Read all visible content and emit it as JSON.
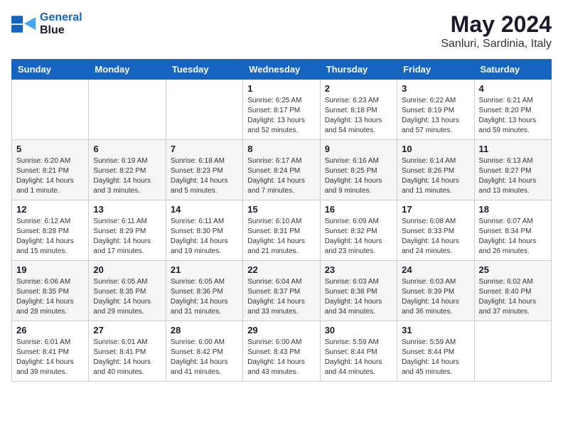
{
  "logo": {
    "line1": "General",
    "line2": "Blue"
  },
  "title": "May 2024",
  "location": "Sanluri, Sardinia, Italy",
  "days_header": [
    "Sunday",
    "Monday",
    "Tuesday",
    "Wednesday",
    "Thursday",
    "Friday",
    "Saturday"
  ],
  "weeks": [
    [
      {
        "day": "",
        "sunrise": "",
        "sunset": "",
        "daylight": ""
      },
      {
        "day": "",
        "sunrise": "",
        "sunset": "",
        "daylight": ""
      },
      {
        "day": "",
        "sunrise": "",
        "sunset": "",
        "daylight": ""
      },
      {
        "day": "1",
        "sunrise": "Sunrise: 6:25 AM",
        "sunset": "Sunset: 8:17 PM",
        "daylight": "Daylight: 13 hours and 52 minutes."
      },
      {
        "day": "2",
        "sunrise": "Sunrise: 6:23 AM",
        "sunset": "Sunset: 8:18 PM",
        "daylight": "Daylight: 13 hours and 54 minutes."
      },
      {
        "day": "3",
        "sunrise": "Sunrise: 6:22 AM",
        "sunset": "Sunset: 8:19 PM",
        "daylight": "Daylight: 13 hours and 57 minutes."
      },
      {
        "day": "4",
        "sunrise": "Sunrise: 6:21 AM",
        "sunset": "Sunset: 8:20 PM",
        "daylight": "Daylight: 13 hours and 59 minutes."
      }
    ],
    [
      {
        "day": "5",
        "sunrise": "Sunrise: 6:20 AM",
        "sunset": "Sunset: 8:21 PM",
        "daylight": "Daylight: 14 hours and 1 minute."
      },
      {
        "day": "6",
        "sunrise": "Sunrise: 6:19 AM",
        "sunset": "Sunset: 8:22 PM",
        "daylight": "Daylight: 14 hours and 3 minutes."
      },
      {
        "day": "7",
        "sunrise": "Sunrise: 6:18 AM",
        "sunset": "Sunset: 8:23 PM",
        "daylight": "Daylight: 14 hours and 5 minutes."
      },
      {
        "day": "8",
        "sunrise": "Sunrise: 6:17 AM",
        "sunset": "Sunset: 8:24 PM",
        "daylight": "Daylight: 14 hours and 7 minutes."
      },
      {
        "day": "9",
        "sunrise": "Sunrise: 6:16 AM",
        "sunset": "Sunset: 8:25 PM",
        "daylight": "Daylight: 14 hours and 9 minutes."
      },
      {
        "day": "10",
        "sunrise": "Sunrise: 6:14 AM",
        "sunset": "Sunset: 8:26 PM",
        "daylight": "Daylight: 14 hours and 11 minutes."
      },
      {
        "day": "11",
        "sunrise": "Sunrise: 6:13 AM",
        "sunset": "Sunset: 8:27 PM",
        "daylight": "Daylight: 14 hours and 13 minutes."
      }
    ],
    [
      {
        "day": "12",
        "sunrise": "Sunrise: 6:12 AM",
        "sunset": "Sunset: 8:28 PM",
        "daylight": "Daylight: 14 hours and 15 minutes."
      },
      {
        "day": "13",
        "sunrise": "Sunrise: 6:11 AM",
        "sunset": "Sunset: 8:29 PM",
        "daylight": "Daylight: 14 hours and 17 minutes."
      },
      {
        "day": "14",
        "sunrise": "Sunrise: 6:11 AM",
        "sunset": "Sunset: 8:30 PM",
        "daylight": "Daylight: 14 hours and 19 minutes."
      },
      {
        "day": "15",
        "sunrise": "Sunrise: 6:10 AM",
        "sunset": "Sunset: 8:31 PM",
        "daylight": "Daylight: 14 hours and 21 minutes."
      },
      {
        "day": "16",
        "sunrise": "Sunrise: 6:09 AM",
        "sunset": "Sunset: 8:32 PM",
        "daylight": "Daylight: 14 hours and 23 minutes."
      },
      {
        "day": "17",
        "sunrise": "Sunrise: 6:08 AM",
        "sunset": "Sunset: 8:33 PM",
        "daylight": "Daylight: 14 hours and 24 minutes."
      },
      {
        "day": "18",
        "sunrise": "Sunrise: 6:07 AM",
        "sunset": "Sunset: 8:34 PM",
        "daylight": "Daylight: 14 hours and 26 minutes."
      }
    ],
    [
      {
        "day": "19",
        "sunrise": "Sunrise: 6:06 AM",
        "sunset": "Sunset: 8:35 PM",
        "daylight": "Daylight: 14 hours and 28 minutes."
      },
      {
        "day": "20",
        "sunrise": "Sunrise: 6:05 AM",
        "sunset": "Sunset: 8:35 PM",
        "daylight": "Daylight: 14 hours and 29 minutes."
      },
      {
        "day": "21",
        "sunrise": "Sunrise: 6:05 AM",
        "sunset": "Sunset: 8:36 PM",
        "daylight": "Daylight: 14 hours and 31 minutes."
      },
      {
        "day": "22",
        "sunrise": "Sunrise: 6:04 AM",
        "sunset": "Sunset: 8:37 PM",
        "daylight": "Daylight: 14 hours and 33 minutes."
      },
      {
        "day": "23",
        "sunrise": "Sunrise: 6:03 AM",
        "sunset": "Sunset: 8:38 PM",
        "daylight": "Daylight: 14 hours and 34 minutes."
      },
      {
        "day": "24",
        "sunrise": "Sunrise: 6:03 AM",
        "sunset": "Sunset: 8:39 PM",
        "daylight": "Daylight: 14 hours and 36 minutes."
      },
      {
        "day": "25",
        "sunrise": "Sunrise: 6:02 AM",
        "sunset": "Sunset: 8:40 PM",
        "daylight": "Daylight: 14 hours and 37 minutes."
      }
    ],
    [
      {
        "day": "26",
        "sunrise": "Sunrise: 6:01 AM",
        "sunset": "Sunset: 8:41 PM",
        "daylight": "Daylight: 14 hours and 39 minutes."
      },
      {
        "day": "27",
        "sunrise": "Sunrise: 6:01 AM",
        "sunset": "Sunset: 8:41 PM",
        "daylight": "Daylight: 14 hours and 40 minutes."
      },
      {
        "day": "28",
        "sunrise": "Sunrise: 6:00 AM",
        "sunset": "Sunset: 8:42 PM",
        "daylight": "Daylight: 14 hours and 41 minutes."
      },
      {
        "day": "29",
        "sunrise": "Sunrise: 6:00 AM",
        "sunset": "Sunset: 8:43 PM",
        "daylight": "Daylight: 14 hours and 43 minutes."
      },
      {
        "day": "30",
        "sunrise": "Sunrise: 5:59 AM",
        "sunset": "Sunset: 8:44 PM",
        "daylight": "Daylight: 14 hours and 44 minutes."
      },
      {
        "day": "31",
        "sunrise": "Sunrise: 5:59 AM",
        "sunset": "Sunset: 8:44 PM",
        "daylight": "Daylight: 14 hours and 45 minutes."
      },
      {
        "day": "",
        "sunrise": "",
        "sunset": "",
        "daylight": ""
      }
    ]
  ]
}
